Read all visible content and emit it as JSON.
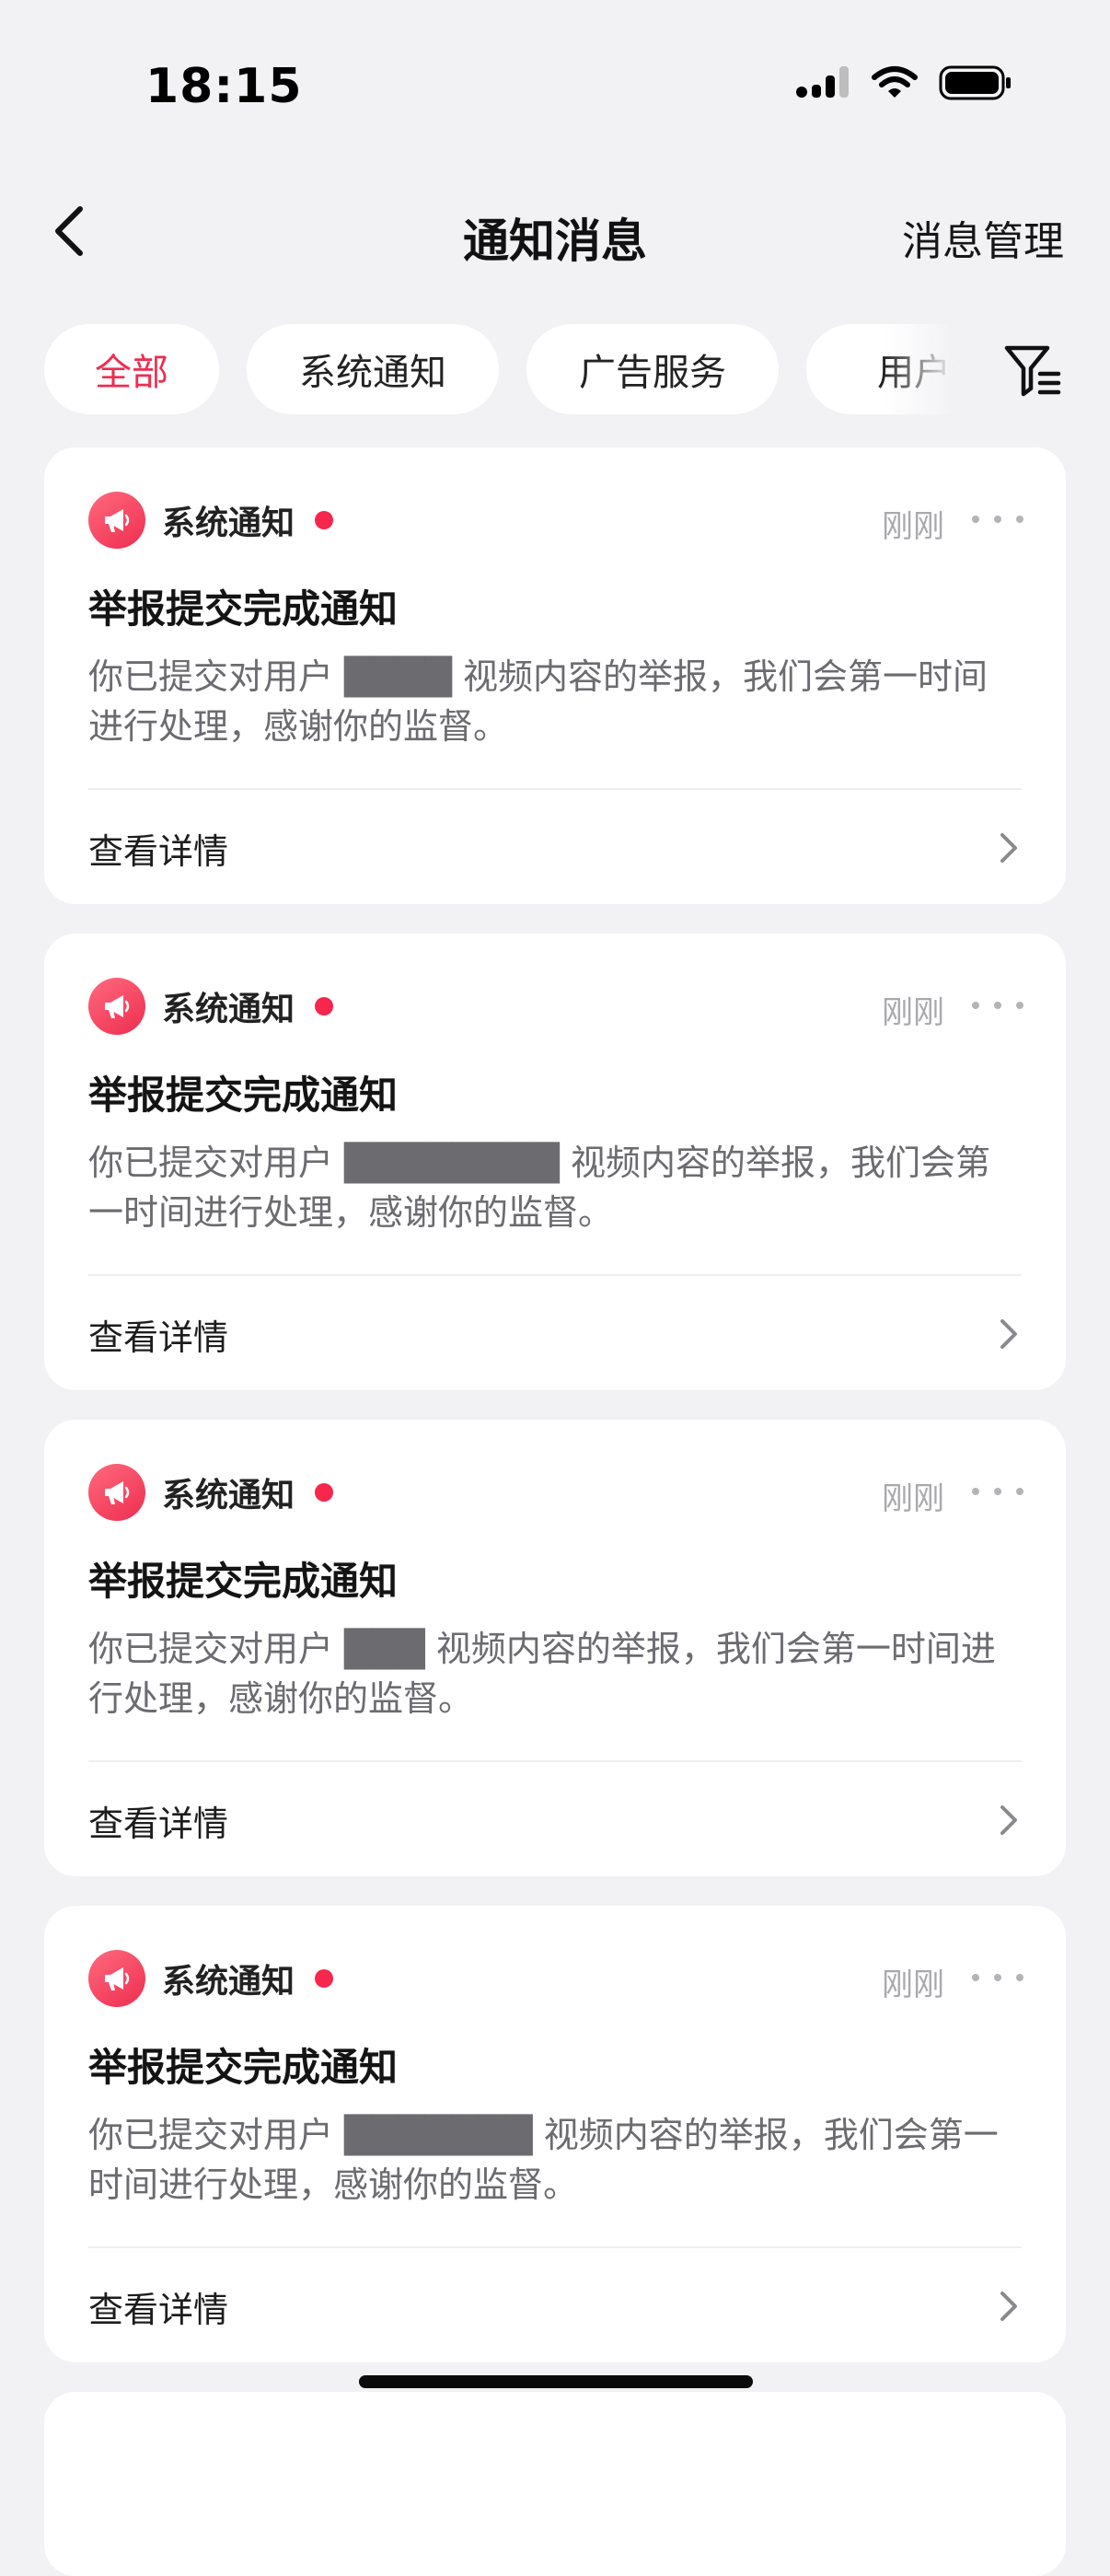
{
  "status_bar": {
    "time": "18:15"
  },
  "header": {
    "title": "通知消息",
    "manage_label": "消息管理"
  },
  "tabs": [
    {
      "label": "全部",
      "active": true
    },
    {
      "label": "系统通知",
      "active": false
    },
    {
      "label": "广告服务",
      "active": false
    },
    {
      "label": "用户订",
      "active": false
    }
  ],
  "notifications": [
    {
      "source": "系统通知",
      "time": "刚刚",
      "title": "举报提交完成通知",
      "body": "你已提交对用户 ████ 视频内容的举报，我们会第一时间进行处理，感谢你的监督。",
      "detail_label": "查看详情"
    },
    {
      "source": "系统通知",
      "time": "刚刚",
      "title": "举报提交完成通知",
      "body": "你已提交对用户 ████████ 视频内容的举报，我们会第一时间进行处理，感谢你的监督。",
      "detail_label": "查看详情"
    },
    {
      "source": "系统通知",
      "time": "刚刚",
      "title": "举报提交完成通知",
      "body": "你已提交对用户 ███ 视频内容的举报，我们会第一时间进行处理，感谢你的监督。",
      "detail_label": "查看详情"
    },
    {
      "source": "系统通知",
      "time": "刚刚",
      "title": "举报提交完成通知",
      "body": "你已提交对用户 ███████ 视频内容的举报，我们会第一时间进行处理，感谢你的监督。",
      "detail_label": "查看详情"
    }
  ],
  "colors": {
    "accent": "#ee2d50",
    "unread_dot": "#f6264d",
    "background": "#f2f2f5"
  },
  "icons": {
    "back": "chevron-left-icon",
    "filter": "filter-icon",
    "source": "megaphone-icon",
    "more": "more-dots-icon",
    "detail": "chevron-right-icon"
  }
}
